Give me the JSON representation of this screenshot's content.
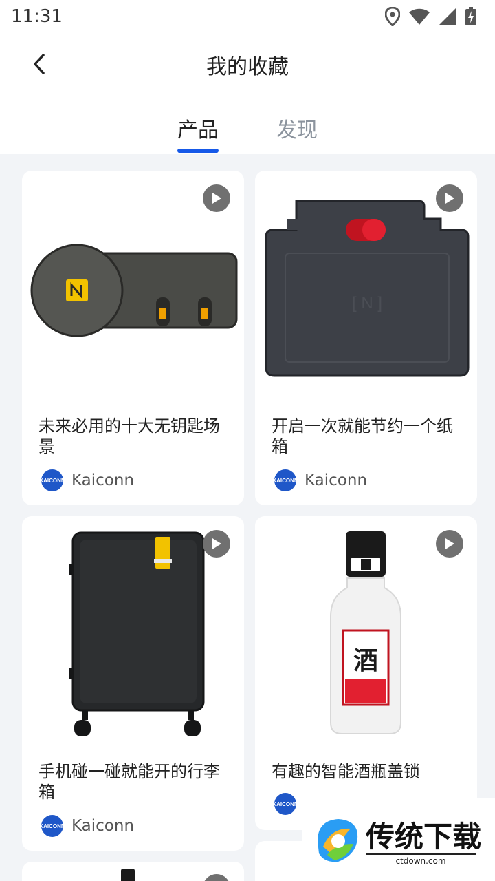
{
  "status_bar": {
    "time": "11:31"
  },
  "header": {
    "title": "我的收藏"
  },
  "tabs": [
    {
      "label": "产品"
    },
    {
      "label": "发现"
    }
  ],
  "cards": [
    {
      "title": "未来必用的十大无钥匙场景",
      "brand": "Kaiconn",
      "image": "nfc-key-lock"
    },
    {
      "title": "开启一次就能节约一个纸箱",
      "brand": "Kaiconn",
      "image": "nfc-box-lock"
    },
    {
      "title": "手机碰一碰就能开的行李箱",
      "brand": "Kaiconn",
      "image": "nfc-suitcase"
    },
    {
      "title": "有趣的智能酒瓶盖锁",
      "brand": "",
      "image": "liquor-bottle"
    }
  ],
  "brand_logo_text": "KAICONN",
  "bottle_label": "酒",
  "watermark": {
    "text": "传统下载",
    "sub": "ctdown.com"
  }
}
